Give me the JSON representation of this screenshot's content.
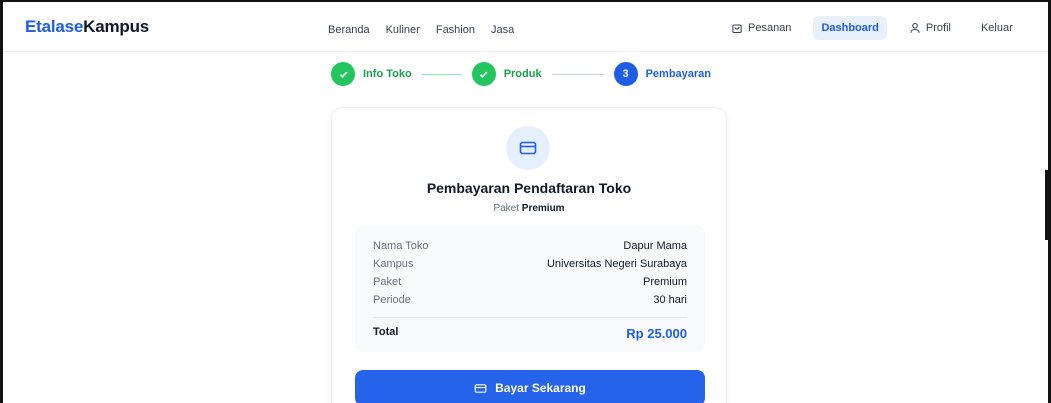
{
  "brand": {
    "part1": "Etalase",
    "part2": "Kampus",
    "accent_color": "#1d5ee8"
  },
  "nav": {
    "links": [
      "Beranda",
      "Kuliner",
      "Fashion",
      "Jasa"
    ],
    "pesanan": "Pesanan",
    "dashboard": "Dashboard",
    "profil": "Profil",
    "keluar": "Keluar"
  },
  "stepper": {
    "steps": [
      {
        "label": "Info Toko",
        "status": "done"
      },
      {
        "label": "Produk",
        "status": "done"
      },
      {
        "label": "Pembayaran",
        "status": "current",
        "number": "3"
      }
    ]
  },
  "card": {
    "icon": "credit-card-icon",
    "title": "Pembayaran Pendaftaran Toko",
    "subtitle_prefix": "Paket",
    "subtitle_package": "Premium",
    "summary": [
      {
        "key": "Nama Toko",
        "value": "Dapur Mama"
      },
      {
        "key": "Kampus",
        "value": "Universitas Negeri Surabaya"
      },
      {
        "key": "Paket",
        "value": "Premium"
      },
      {
        "key": "Periode",
        "value": "30 hari"
      }
    ],
    "total_label": "Total",
    "total_value": "Rp 25.000",
    "pay_button": "Bayar Sekarang"
  },
  "colors": {
    "primary": "#2563eb",
    "success": "#22c55e"
  }
}
